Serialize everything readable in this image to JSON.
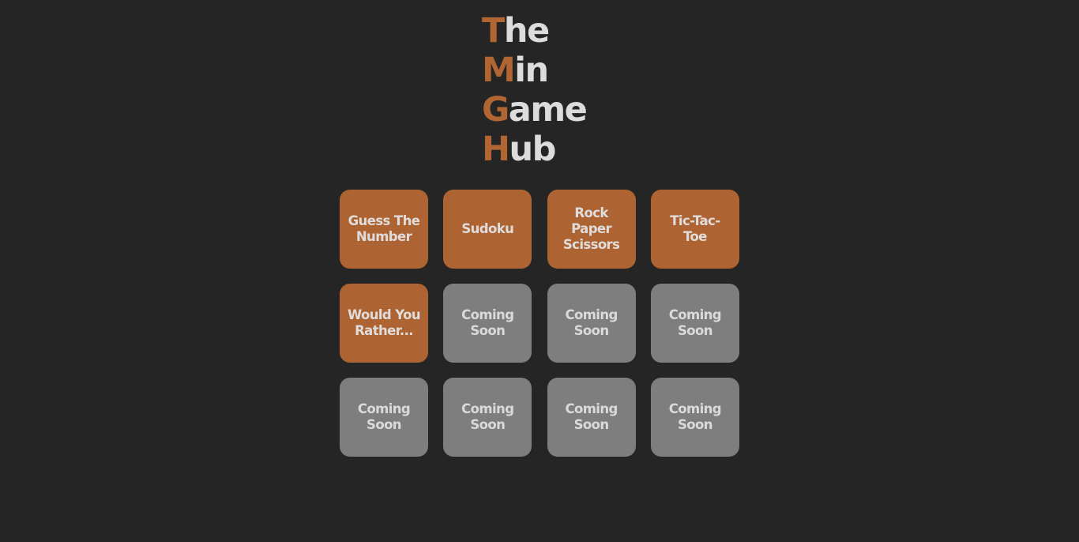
{
  "header": {
    "title_lines": [
      {
        "initial": "T",
        "rest": "he"
      },
      {
        "initial": "M",
        "rest": "in"
      },
      {
        "initial": "G",
        "rest": "ame"
      },
      {
        "initial": "H",
        "rest": "ub"
      }
    ]
  },
  "colors": {
    "background": "#252525",
    "accent": "#ad6432",
    "disabled": "#7e7e7e",
    "text": "#dcdcdc"
  },
  "games": [
    {
      "label": "Guess The Number",
      "status": "available"
    },
    {
      "label": "Sudoku",
      "status": "available"
    },
    {
      "label": "Rock Paper Scissors",
      "status": "available"
    },
    {
      "label": "Tic-Tac-Toe",
      "status": "available"
    },
    {
      "label": "Would You Rather...",
      "status": "available"
    },
    {
      "label": "Coming Soon",
      "status": "coming-soon"
    },
    {
      "label": "Coming Soon",
      "status": "coming-soon"
    },
    {
      "label": "Coming Soon",
      "status": "coming-soon"
    },
    {
      "label": "Coming Soon",
      "status": "coming-soon"
    },
    {
      "label": "Coming Soon",
      "status": "coming-soon"
    },
    {
      "label": "Coming Soon",
      "status": "coming-soon"
    },
    {
      "label": "Coming Soon",
      "status": "coming-soon"
    }
  ]
}
